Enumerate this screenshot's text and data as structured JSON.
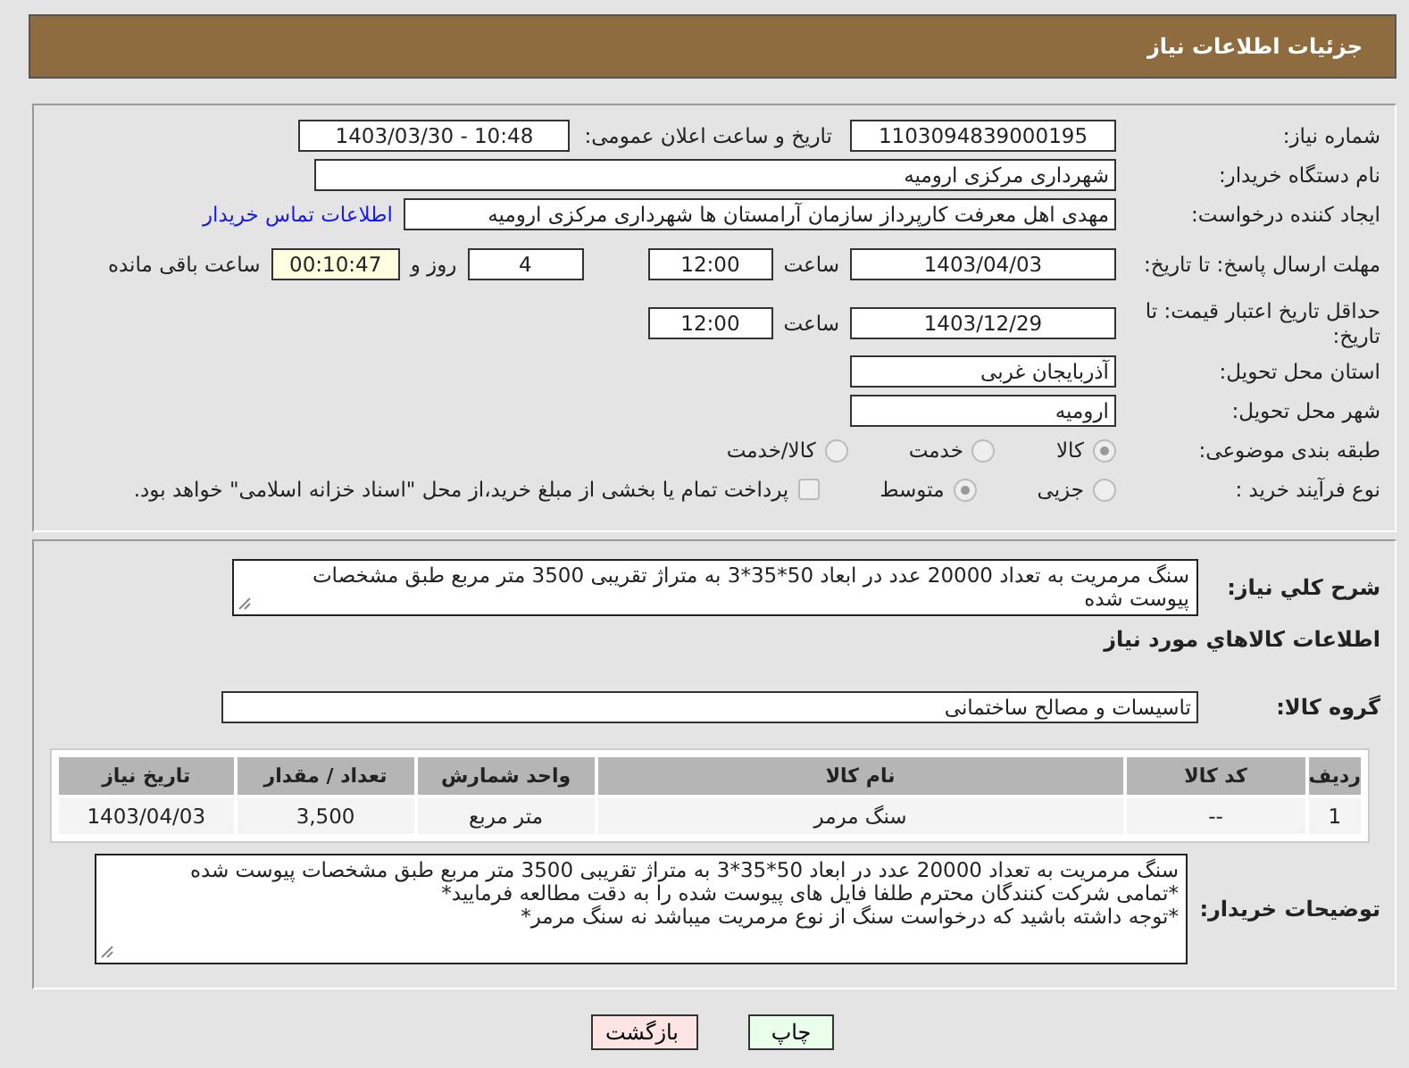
{
  "header": {
    "title": "جزئیات اطلاعات نیاز"
  },
  "need_number": {
    "label": "شماره نیاز:",
    "value": "1103094839000195"
  },
  "announce": {
    "label": "تاریخ و ساعت اعلان عمومی:",
    "value": "1403/03/30 - 10:48"
  },
  "buyer": {
    "label": "نام دستگاه خریدار:",
    "value": "شهرداری مرکزی ارومیه"
  },
  "requester": {
    "label": "ایجاد کننده درخواست:",
    "value": "مهدی اهل معرفت کارپرداز سازمان آرامستان ها شهرداری مرکزی ارومیه",
    "link": "اطلاعات تماس خریدار"
  },
  "deadline": {
    "label": "مهلت ارسال پاسخ: تا تاریخ:",
    "date": "1403/04/03",
    "time_label": "ساعت",
    "time": "12:00",
    "days": "4",
    "days_label": "روز و",
    "remaining": "00:10:47",
    "remaining_label": "ساعت باقی مانده"
  },
  "validity": {
    "label": "حداقل تاریخ اعتبار قیمت: تا تاریخ:",
    "date": "1403/12/29",
    "time_label": "ساعت",
    "time": "12:00"
  },
  "province": {
    "label": "استان محل تحویل:",
    "value": "آذربایجان غربی"
  },
  "city": {
    "label": "شهر محل تحویل:",
    "value": "ارومیه"
  },
  "category": {
    "label": "طبقه بندی موضوعی:",
    "options": [
      {
        "label": "كالا",
        "selected": true
      },
      {
        "label": "خدمت",
        "selected": false
      },
      {
        "label": "كالا/خدمت",
        "selected": false
      }
    ]
  },
  "process": {
    "label": "نوع فرآیند خرید :",
    "options": [
      {
        "label": "جزیی",
        "selected": false
      },
      {
        "label": "متوسط",
        "selected": true
      }
    ],
    "payment": {
      "label": "پرداخت تمام یا بخشی از مبلغ خرید،از محل \"اسناد خزانه اسلامی\" خواهد بود.",
      "checked": false
    }
  },
  "description": {
    "label": "شرح كلي نياز:",
    "value": "سنگ مرمریت به تعداد 20000 عدد در ابعاد 50*35*3 به متراژ تقریبی 3500 متر مربع طبق مشخصات پیوست شده"
  },
  "goods_heading": "اطلاعات كالاهاي مورد نياز",
  "goods_group": {
    "label": "گروه كالا:",
    "value": "تاسیسات و مصالح ساختمانی"
  },
  "table": {
    "columns": [
      "ردیف",
      "کد کالا",
      "نام کالا",
      "واحد شمارش",
      "تعداد / مقدار",
      "تاریخ نیاز"
    ],
    "rows": [
      [
        "1",
        "--",
        "سنگ مرمر",
        "متر مربع",
        "3,500",
        "1403/04/03"
      ]
    ]
  },
  "buyer_notes": {
    "label": "توضیحات خریدار:",
    "lines": [
      "سنگ مرمریت به تعداد 20000 عدد در ابعاد 50*35*3 به متراژ تقریبی 3500 متر مربع طبق مشخصات پیوست شده",
      "*تمامی شرکت کنندگان محترم طلفا فایل های پیوست شده را به دقت مطالعه فرمایید*",
      "*توجه داشته باشید که درخواست سنگ از نوع مرمریت میباشد نه سنگ مرمر*"
    ]
  },
  "buttons": [
    {
      "label": "چاپ",
      "kind": "print"
    },
    {
      "label": "بازگشت",
      "kind": "back"
    }
  ]
}
